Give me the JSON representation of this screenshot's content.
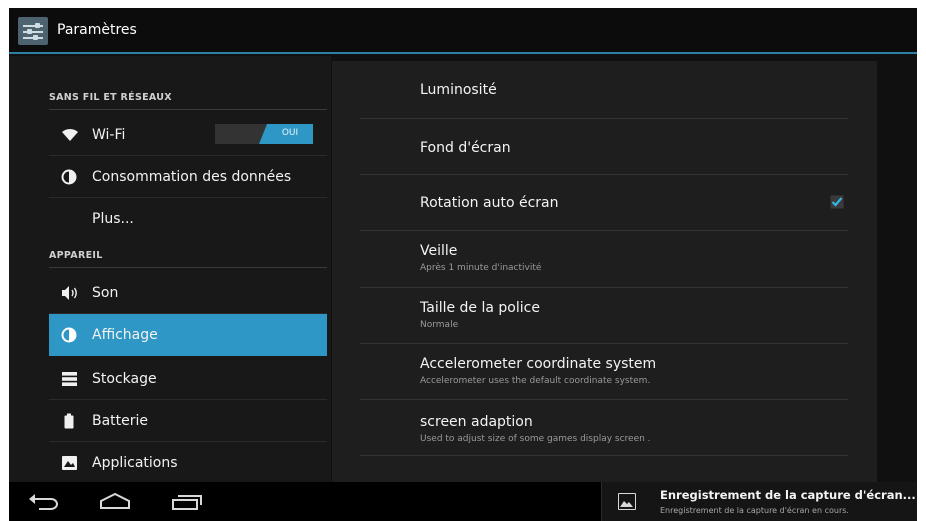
{
  "app": {
    "title": "Paramètres",
    "icon": "settings-sliders-icon"
  },
  "left_panel": {
    "sections": [
      {
        "header": "SANS FIL ET RÉSEAUX"
      },
      {
        "header": "APPAREIL"
      }
    ],
    "items": [
      {
        "label": "Wi-Fi",
        "icon": "wifi-icon",
        "toggle": "OUI"
      },
      {
        "label": "Consommation des données",
        "icon": "data-usage-icon"
      },
      {
        "label": "Plus..."
      },
      {
        "label": "Son",
        "icon": "speaker-icon"
      },
      {
        "label": "Affichage",
        "icon": "display-icon",
        "selected": true
      },
      {
        "label": "Stockage",
        "icon": "storage-icon"
      },
      {
        "label": "Batterie",
        "icon": "battery-icon"
      },
      {
        "label": "Applications",
        "icon": "applications-icon"
      }
    ]
  },
  "right_panel": {
    "items": [
      {
        "title": "Luminosité"
      },
      {
        "title": "Fond d'écran"
      },
      {
        "title": "Rotation auto écran",
        "checked": true
      },
      {
        "title": "Veille",
        "summary": "Après 1 minute d'inactivité"
      },
      {
        "title": "Taille de la police",
        "summary": "Normale"
      },
      {
        "title": "Accelerometer coordinate system",
        "summary": "Accelerometer uses the default coordinate system."
      },
      {
        "title": "screen adaption",
        "summary": "Used to adjust size of some games display screen ."
      }
    ]
  },
  "system_bar": {
    "buttons": [
      "back-icon",
      "home-icon",
      "recent-apps-icon"
    ],
    "notification": {
      "icon": "image-icon",
      "title": "Enregistrement de la capture d'écran...",
      "text": "Enregistrement de la capture d'écran en cours."
    }
  },
  "colors": {
    "accent": "#2e97c6",
    "background": "#101010",
    "panel": "#1e1e1e"
  }
}
